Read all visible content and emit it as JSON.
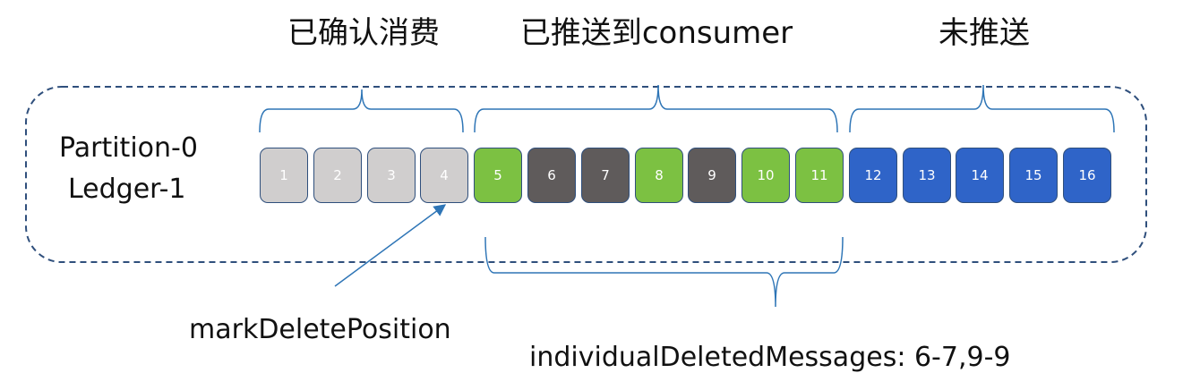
{
  "sections": {
    "acked": "已确认消费",
    "dispatched": "已推送到consumer",
    "pending": "未推送"
  },
  "partition": {
    "line1": "Partition-0",
    "line2": "Ledger-1"
  },
  "pointers": {
    "mark_delete_position": "markDeletePosition",
    "individual_deleted_messages": "individualDeletedMessages: 6-7,9-9"
  },
  "colors": {
    "acked": "#d0cece",
    "acked_text": "#ffffff",
    "dispatched_green": "#7cc142",
    "dispatched_gray": "#5f5b5b",
    "pending_blue": "#2f64c8",
    "cell_text": "#ffffff",
    "border": "#2f4f7c",
    "bracket": "#2e75b6",
    "arrow": "#2e75b6"
  },
  "messages": [
    {
      "id": "1",
      "state": "acked"
    },
    {
      "id": "2",
      "state": "acked"
    },
    {
      "id": "3",
      "state": "acked"
    },
    {
      "id": "4",
      "state": "acked"
    },
    {
      "id": "5",
      "state": "dispatched_green"
    },
    {
      "id": "6",
      "state": "dispatched_gray"
    },
    {
      "id": "7",
      "state": "dispatched_gray"
    },
    {
      "id": "8",
      "state": "dispatched_green"
    },
    {
      "id": "9",
      "state": "dispatched_gray"
    },
    {
      "id": "10",
      "state": "dispatched_green"
    },
    {
      "id": "11",
      "state": "dispatched_green"
    },
    {
      "id": "12",
      "state": "pending_blue"
    },
    {
      "id": "13",
      "state": "pending_blue"
    },
    {
      "id": "14",
      "state": "pending_blue"
    },
    {
      "id": "15",
      "state": "pending_blue"
    },
    {
      "id": "16",
      "state": "pending_blue"
    }
  ]
}
